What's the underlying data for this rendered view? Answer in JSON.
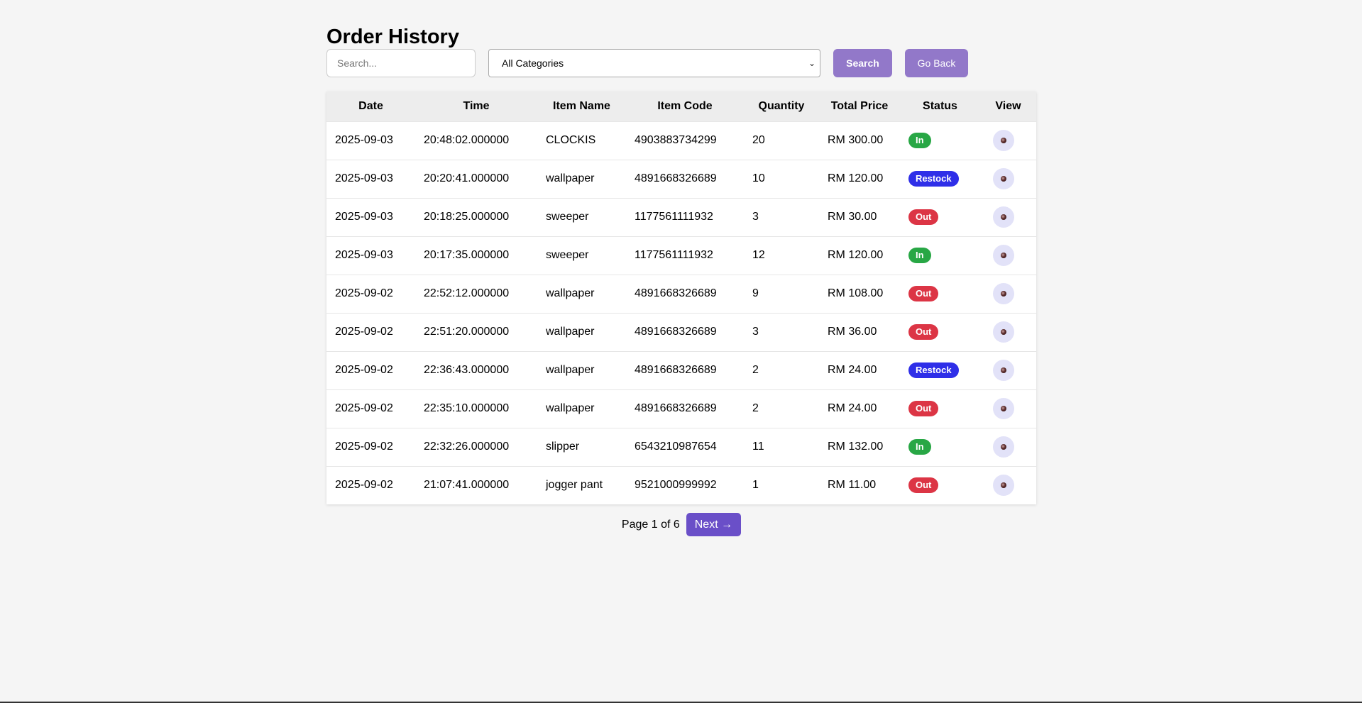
{
  "header": {
    "title": "Order History"
  },
  "controls": {
    "search_placeholder": "Search...",
    "category_selected": "All Categories",
    "search_label": "Search",
    "back_label": "Go Back"
  },
  "table": {
    "columns": [
      "Date",
      "Time",
      "Item Name",
      "Item Code",
      "Quantity",
      "Total Price",
      "Status",
      "View"
    ],
    "rows": [
      {
        "date": "2025-09-03",
        "time": "20:48:02.000000",
        "name": "CLOCKIS",
        "code": "4903883734299",
        "qty": "20",
        "price": "RM 300.00",
        "status": "In"
      },
      {
        "date": "2025-09-03",
        "time": "20:20:41.000000",
        "name": "wallpaper",
        "code": "4891668326689",
        "qty": "10",
        "price": "RM 120.00",
        "status": "Restock"
      },
      {
        "date": "2025-09-03",
        "time": "20:18:25.000000",
        "name": "sweeper",
        "code": "1177561111932",
        "qty": "3",
        "price": "RM 30.00",
        "status": "Out"
      },
      {
        "date": "2025-09-03",
        "time": "20:17:35.000000",
        "name": "sweeper",
        "code": "1177561111932",
        "qty": "12",
        "price": "RM 120.00",
        "status": "In"
      },
      {
        "date": "2025-09-02",
        "time": "22:52:12.000000",
        "name": "wallpaper",
        "code": "4891668326689",
        "qty": "9",
        "price": "RM 108.00",
        "status": "Out"
      },
      {
        "date": "2025-09-02",
        "time": "22:51:20.000000",
        "name": "wallpaper",
        "code": "4891668326689",
        "qty": "3",
        "price": "RM 36.00",
        "status": "Out"
      },
      {
        "date": "2025-09-02",
        "time": "22:36:43.000000",
        "name": "wallpaper",
        "code": "4891668326689",
        "qty": "2",
        "price": "RM 24.00",
        "status": "Restock"
      },
      {
        "date": "2025-09-02",
        "time": "22:35:10.000000",
        "name": "wallpaper",
        "code": "4891668326689",
        "qty": "2",
        "price": "RM 24.00",
        "status": "Out"
      },
      {
        "date": "2025-09-02",
        "time": "22:32:26.000000",
        "name": "slipper",
        "code": "6543210987654",
        "qty": "11",
        "price": "RM 132.00",
        "status": "In"
      },
      {
        "date": "2025-09-02",
        "time": "21:07:41.000000",
        "name": "jogger pant",
        "code": "9521000999992",
        "qty": "1",
        "price": "RM 11.00",
        "status": "Out"
      }
    ]
  },
  "status_colors": {
    "In": "#28a745",
    "Restock": "#2f2fe8",
    "Out": "#dc3545"
  },
  "icons": {
    "view": "eye-icon",
    "select": "chevron-down-icon",
    "next": "arrow-right-icon"
  },
  "pagination": {
    "label": "Page 1 of 6",
    "next_label": "Next →"
  },
  "colors": {
    "accent": "#9278c9",
    "next_button": "#6a4fc8",
    "background": "#f5f5f5"
  }
}
